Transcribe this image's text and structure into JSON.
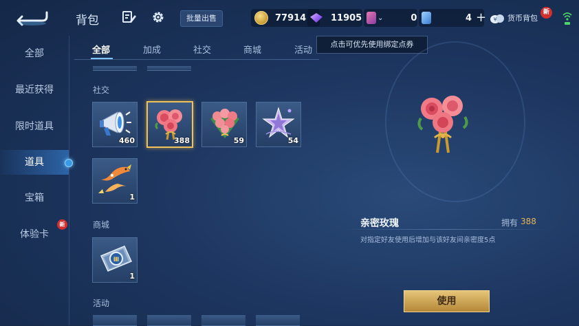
{
  "header": {
    "title": "背包",
    "bulk_sell_label": "批量出售",
    "gold_coins": "77914",
    "diamonds": "11905",
    "voucher_count": "0",
    "points_count": "4",
    "wallet_label": "货币背包",
    "wallet_badge": "新",
    "tooltip": "点击可优先使用绑定点券"
  },
  "sidebar": {
    "items": [
      {
        "label": "全部"
      },
      {
        "label": "最近获得"
      },
      {
        "label": "限时道具"
      },
      {
        "label": "道具"
      },
      {
        "label": "宝箱"
      },
      {
        "label": "体验卡"
      }
    ],
    "active_index": 3,
    "trial_badge": "新"
  },
  "tabs": [
    "全部",
    "加成",
    "社交",
    "商城",
    "活动"
  ],
  "active_tab": 0,
  "sections": {
    "social": {
      "title": "社交",
      "items": [
        {
          "icon": "megaphone-icon",
          "count": "460"
        },
        {
          "icon": "rose-bouquet-icon",
          "count": "388",
          "selected": true
        },
        {
          "icon": "rose-basket-icon",
          "count": "59"
        },
        {
          "icon": "star-charm-icon",
          "count": "54"
        },
        {
          "icon": "koi-fish-icon",
          "count": "1"
        }
      ]
    },
    "mall": {
      "title": "商城",
      "items": [
        {
          "icon": "ticket-card-icon",
          "count": "1"
        }
      ]
    },
    "activity": {
      "title": "活动"
    }
  },
  "detail": {
    "name": "亲密玫瑰",
    "owned_label": "拥有",
    "owned_count": "388",
    "description": "对指定好友使用后增加与该好友间亲密度5点",
    "use_label": "使用"
  },
  "colors": {
    "accent_gold": "#e3b75a",
    "selection_border": "#f0c25a",
    "background": "#1d3660"
  }
}
